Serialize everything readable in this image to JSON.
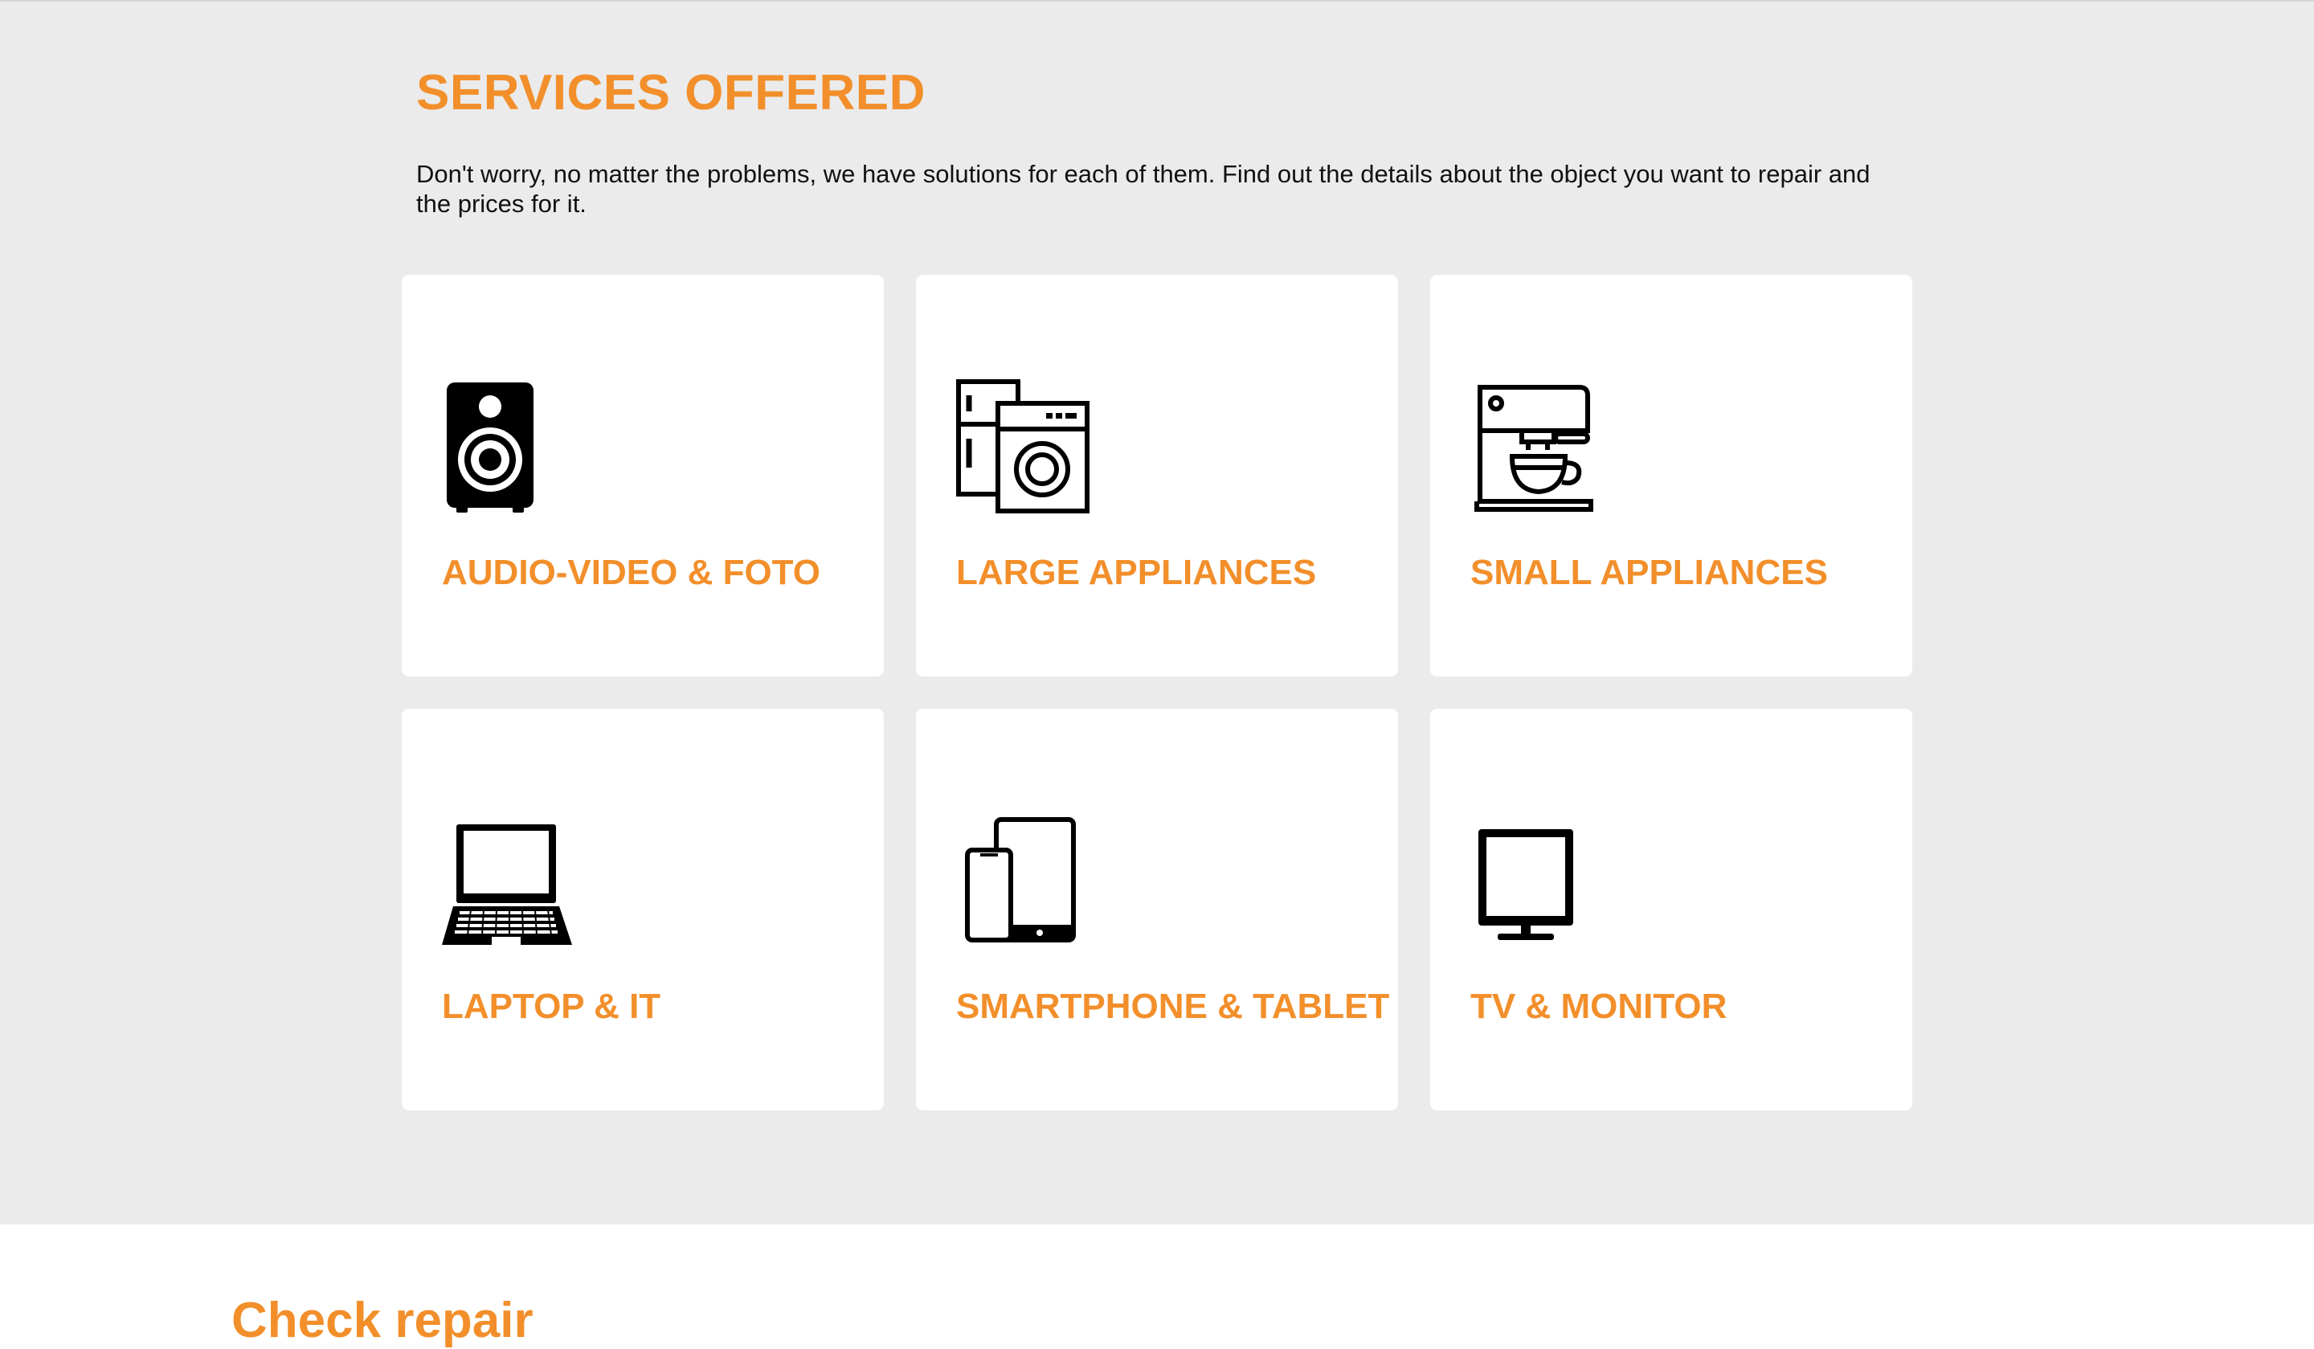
{
  "services": {
    "title": "SERVICES OFFERED",
    "description": "Don't worry, no matter the problems, we have solutions for each of them. Find out the details about the object you want to repair and the prices for it.",
    "accent_color": "#f28f2b",
    "cards": [
      {
        "label": "AUDIO-VIDEO & FOTO",
        "icon": "speaker-icon"
      },
      {
        "label": "LARGE APPLIANCES",
        "icon": "fridge-washer-icon"
      },
      {
        "label": "SMALL APPLIANCES",
        "icon": "coffee-machine-icon"
      },
      {
        "label": "LAPTOP & IT",
        "icon": "laptop-icon"
      },
      {
        "label": "SMARTPHONE & TABLET",
        "icon": "phone-tablet-icon"
      },
      {
        "label": "TV & MONITOR",
        "icon": "monitor-icon"
      }
    ]
  },
  "next_section": {
    "title": "Check repair"
  }
}
